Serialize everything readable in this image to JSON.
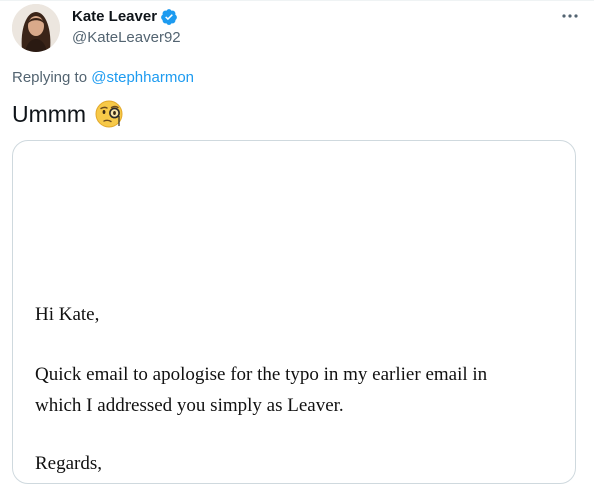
{
  "tweet": {
    "display_name": "Kate Leaver",
    "handle": "@KateLeaver92",
    "verified": true,
    "replying_prefix": "Replying to",
    "replying_to": "@stephharmon",
    "text": "Ummm",
    "emoji_icon": "face-with-monocle-icon",
    "more_icon": "more-horizontal-icon"
  },
  "email_image": {
    "greeting": "Hi Kate,",
    "body_line_1": "Quick email to apologise for the typo in my earlier email in",
    "body_line_2": "which I addressed you simply as Leaver.",
    "signoff": "Regards,"
  },
  "colors": {
    "link": "#1d9bf0",
    "secondary_text": "#536471",
    "primary_text": "#0f1419",
    "border": "#cfd9de"
  }
}
